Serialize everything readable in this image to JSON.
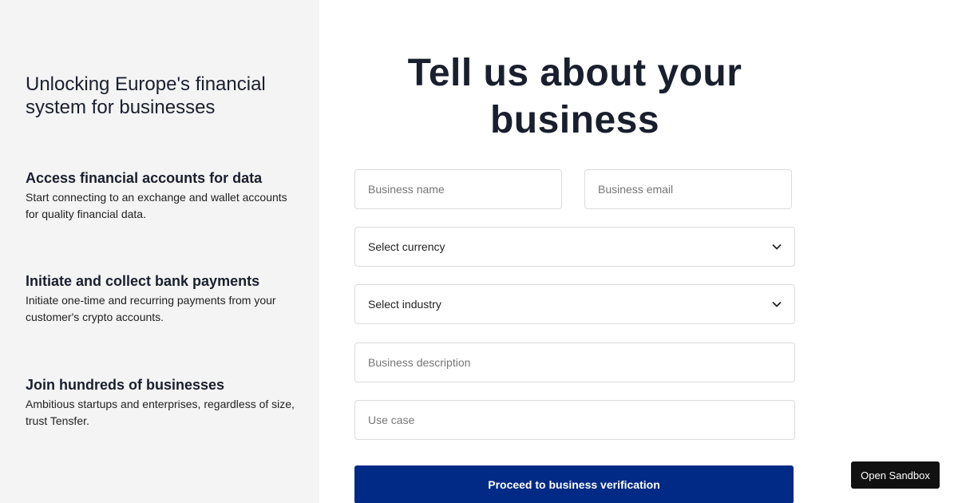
{
  "sidebar": {
    "tagline": "Unlocking Europe's financial system for businesses",
    "features": [
      {
        "title": "Access financial accounts for data",
        "description": "Start connecting to an exchange and wallet accounts for quality financial data."
      },
      {
        "title": "Initiate and collect bank payments",
        "description": "Initiate one-time and recurring payments from your customer's crypto accounts."
      },
      {
        "title": "Join hundreds of businesses",
        "description": "Ambitious startups and enterprises, regardless of size, trust Tensfer."
      }
    ]
  },
  "form": {
    "heading": "Tell us about your business",
    "business_name": {
      "value": "",
      "placeholder": "Business name"
    },
    "business_email": {
      "value": "",
      "placeholder": "Business email"
    },
    "currency": {
      "selected": "Select currency",
      "icon": "chevron-down-icon"
    },
    "industry": {
      "selected": "Select industry",
      "icon": "chevron-down-icon"
    },
    "business_description": {
      "value": "",
      "placeholder": "Business description"
    },
    "use_case": {
      "value": "",
      "placeholder": "Use case"
    },
    "submit_label": "Proceed to business verification"
  },
  "sandbox_button": {
    "label": "Open Sandbox"
  },
  "colors": {
    "sidebar_bg": "#f4f4f4",
    "primary": "#002a85",
    "text": "#1a1f2e",
    "sandbox_bg": "#111111"
  }
}
